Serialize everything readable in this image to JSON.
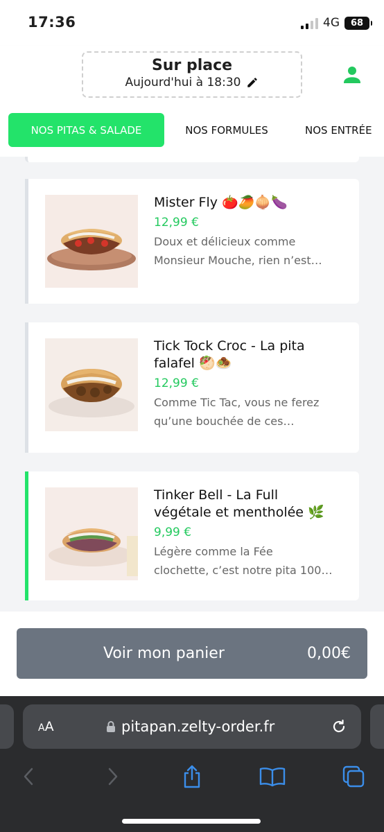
{
  "status": {
    "time": "17:36",
    "network": "4G",
    "battery": "68"
  },
  "header": {
    "mode_title": "Sur place",
    "mode_time": "Aujourd'hui à 18:30"
  },
  "tabs": [
    {
      "label": "NOS PITAS & SALADE",
      "active": true
    },
    {
      "label": "NOS FORMULES",
      "active": false
    },
    {
      "label": "NOS ENTRÉE",
      "active": false
    }
  ],
  "products": [
    {
      "name": "Mister Fly 🍅🥭🧅🍆",
      "price": "12,99 €",
      "desc_line1": "Doux et délicieux comme",
      "desc_line2": "Monsieur Mouche, rien n’est…"
    },
    {
      "name_line1": "Tick Tock Croc - La pita",
      "name_line2": "falafel 🥙🧆",
      "price": "12,99 €",
      "desc_line1": "Comme Tic Tac, vous ne ferez",
      "desc_line2": "qu’une bouchée de ces…"
    },
    {
      "name_line1": "Tinker Bell - La Full",
      "name_line2": "végétale et mentholée 🌿",
      "price": "9,99 €",
      "desc_line1": "Légère comme la Fée",
      "desc_line2": "clochette, c’est notre pita 100…"
    }
  ],
  "cart": {
    "label": "Voir mon panier",
    "total": "0,00€"
  },
  "browser": {
    "aa_small": "A",
    "aa_large": "A",
    "url": "pitapan.zelty-order.fr"
  },
  "colors": {
    "accent": "#23e36a",
    "price": "#23c95e",
    "cart_bg": "#6b7480",
    "browser_bg": "#2b2c2e",
    "ios_blue": "#3b8eea"
  },
  "icons": [
    "pencil-icon",
    "user-icon",
    "lock-icon",
    "reload-icon",
    "back-icon",
    "forward-icon",
    "share-icon",
    "bookmarks-icon",
    "tabs-icon"
  ]
}
